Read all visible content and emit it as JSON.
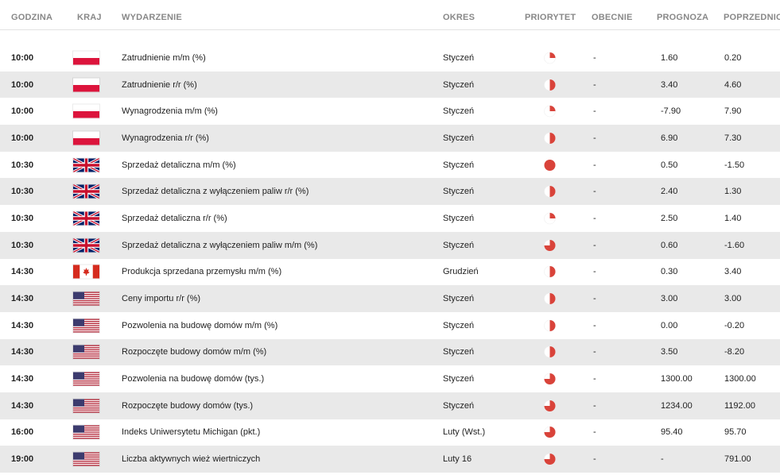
{
  "headers": {
    "time": "GODZINA",
    "country": "KRAJ",
    "event": "WYDARZENIE",
    "period": "OKRES",
    "priority": "PRIORYTET",
    "actual": "OBECNIE",
    "forecast": "PROGNOZA",
    "previous": "POPRZEDNIO"
  },
  "colors": {
    "accent": "#d9433a",
    "row_alt": "#e9e9e9"
  },
  "rows": [
    {
      "time": "10:00",
      "flag": "PL",
      "event": "Zatrudnienie m/m (%)",
      "period": "Styczeń",
      "priority": "low",
      "actual": "-",
      "forecast": "1.60",
      "previous": "0.20"
    },
    {
      "time": "10:00",
      "flag": "PL",
      "event": "Zatrudnienie r/r (%)",
      "period": "Styczeń",
      "priority": "medium",
      "actual": "-",
      "forecast": "3.40",
      "previous": "4.60"
    },
    {
      "time": "10:00",
      "flag": "PL",
      "event": "Wynagrodzenia m/m (%)",
      "period": "Styczeń",
      "priority": "low",
      "actual": "-",
      "forecast": "-7.90",
      "previous": "7.90"
    },
    {
      "time": "10:00",
      "flag": "PL",
      "event": "Wynagrodzenia r/r (%)",
      "period": "Styczeń",
      "priority": "medium",
      "actual": "-",
      "forecast": "6.90",
      "previous": "7.30"
    },
    {
      "time": "10:30",
      "flag": "GB",
      "event": "Sprzedaż detaliczna m/m (%)",
      "period": "Styczeń",
      "priority": "high",
      "actual": "-",
      "forecast": "0.50",
      "previous": "-1.50"
    },
    {
      "time": "10:30",
      "flag": "GB",
      "event": "Sprzedaż detaliczna z wyłączeniem paliw r/r (%)",
      "period": "Styczeń",
      "priority": "medium",
      "actual": "-",
      "forecast": "2.40",
      "previous": "1.30"
    },
    {
      "time": "10:30",
      "flag": "GB",
      "event": "Sprzedaż detaliczna r/r (%)",
      "period": "Styczeń",
      "priority": "low",
      "actual": "-",
      "forecast": "2.50",
      "previous": "1.40"
    },
    {
      "time": "10:30",
      "flag": "GB",
      "event": "Sprzedaż detaliczna z wyłączeniem paliw m/m (%)",
      "period": "Styczeń",
      "priority": "medium-high",
      "actual": "-",
      "forecast": "0.60",
      "previous": "-1.60"
    },
    {
      "time": "14:30",
      "flag": "CA",
      "event": "Produkcja sprzedana przemysłu m/m (%)",
      "period": "Grudzień",
      "priority": "medium",
      "actual": "-",
      "forecast": "0.30",
      "previous": "3.40"
    },
    {
      "time": "14:30",
      "flag": "US",
      "event": "Ceny importu r/r (%)",
      "period": "Styczeń",
      "priority": "medium",
      "actual": "-",
      "forecast": "3.00",
      "previous": "3.00"
    },
    {
      "time": "14:30",
      "flag": "US",
      "event": "Pozwolenia na budowę domów m/m (%)",
      "period": "Styczeń",
      "priority": "medium",
      "actual": "-",
      "forecast": "0.00",
      "previous": "-0.20"
    },
    {
      "time": "14:30",
      "flag": "US",
      "event": "Rozpoczęte budowy domów m/m (%)",
      "period": "Styczeń",
      "priority": "medium",
      "actual": "-",
      "forecast": "3.50",
      "previous": "-8.20"
    },
    {
      "time": "14:30",
      "flag": "US",
      "event": "Pozwolenia na budowę domów (tys.)",
      "period": "Styczeń",
      "priority": "medium-high",
      "actual": "-",
      "forecast": "1300.00",
      "previous": "1300.00"
    },
    {
      "time": "14:30",
      "flag": "US",
      "event": "Rozpoczęte budowy domów (tys.)",
      "period": "Styczeń",
      "priority": "medium-high",
      "actual": "-",
      "forecast": "1234.00",
      "previous": "1192.00"
    },
    {
      "time": "16:00",
      "flag": "US",
      "event": "Indeks Uniwersytetu Michigan (pkt.)",
      "period": "Luty (Wst.)",
      "priority": "medium-high",
      "actual": "-",
      "forecast": "95.40",
      "previous": "95.70"
    },
    {
      "time": "19:00",
      "flag": "US",
      "event": "Liczba aktywnych wież wiertniczych",
      "period": "Luty 16",
      "priority": "medium-high",
      "actual": "-",
      "forecast": "-",
      "previous": "791.00"
    }
  ]
}
